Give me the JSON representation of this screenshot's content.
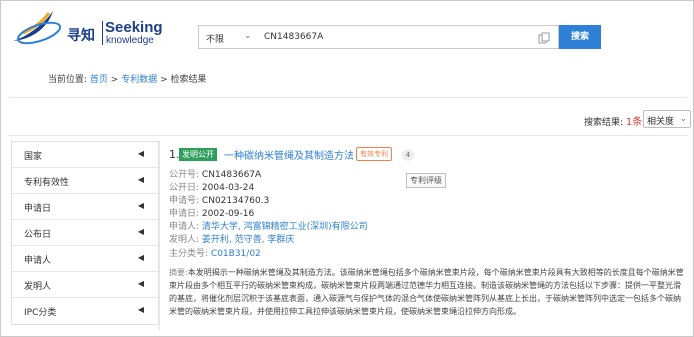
{
  "logo": {
    "cn": "寻知",
    "en_top": "Seeking",
    "en_bottom": "knowledge"
  },
  "search": {
    "select_value": "不限",
    "query": "CN1483667A",
    "button_label": "搜索"
  },
  "breadcrumb": {
    "prefix": "当前位置:",
    "home": "首页",
    "sep1": " > ",
    "patent": "专利数据",
    "sep2": " > ",
    "current": "检索结果"
  },
  "results_bar": {
    "label": "搜索结果:",
    "count": "1条",
    "sort_value": "相关度"
  },
  "sidebar": {
    "items": [
      {
        "label": "国家"
      },
      {
        "label": "专利有效性"
      },
      {
        "label": "申请日"
      },
      {
        "label": "公布日"
      },
      {
        "label": "申请人"
      },
      {
        "label": "发明人"
      },
      {
        "label": "IPC分类"
      }
    ]
  },
  "result": {
    "number": "1.",
    "pub_badge": "发明公开",
    "title": "一种碳纳米管绳及其制造方法",
    "valid_badge": "有效专利",
    "count_badge": "4",
    "rating_button": "专利评级",
    "fields": [
      {
        "key": "公开号:",
        "value": "CN1483667A"
      },
      {
        "key": "公开日:",
        "value": "2004-03-24"
      },
      {
        "key": "申请号:",
        "value": "CN02134760.3"
      },
      {
        "key": "申请日:",
        "value": "2002-09-16"
      },
      {
        "key": "申请人:",
        "value": "清华大学, 鸿富锦精密工业(深圳)有限公司"
      },
      {
        "key": "发明人:",
        "value": "姜开利, 范守善, 李群庆"
      },
      {
        "key": "主分类号:",
        "value": "C01B31/02"
      }
    ],
    "abstract_label": "摘要:",
    "abstract": "本发明揭示一种碳纳米管绳及其制造方法。该碳纳米管绳包括多个碳纳米管束片段，每个碳纳米管束片段具有大致相等的长度且每个碳纳米管束片段由多个相互平行的碳纳米管束构成，碳纳米管束片段两端通过范德华力相互连接。制造该碳纳米管绳的方法包括以下步骤：提供一平整光滑的基底，将催化剂层沉积于该基底表面，通入碳源气与保护气体的混合气体使碳纳米管阵列从基底上长出，于碳纳米管阵列中选定一包括多个碳纳米管的碳纳米管束片段，并使用拉伸工具拉伸该碳纳米管束片段，使碳纳米管束绳沿拉伸方向形成。"
  },
  "colors": {
    "brand_blue": "#1c3f8c",
    "accent": "#2e7fd6",
    "green_badge": "#2e9e5b",
    "red_count": "#e53935",
    "orange_badge": "#f0824a"
  }
}
